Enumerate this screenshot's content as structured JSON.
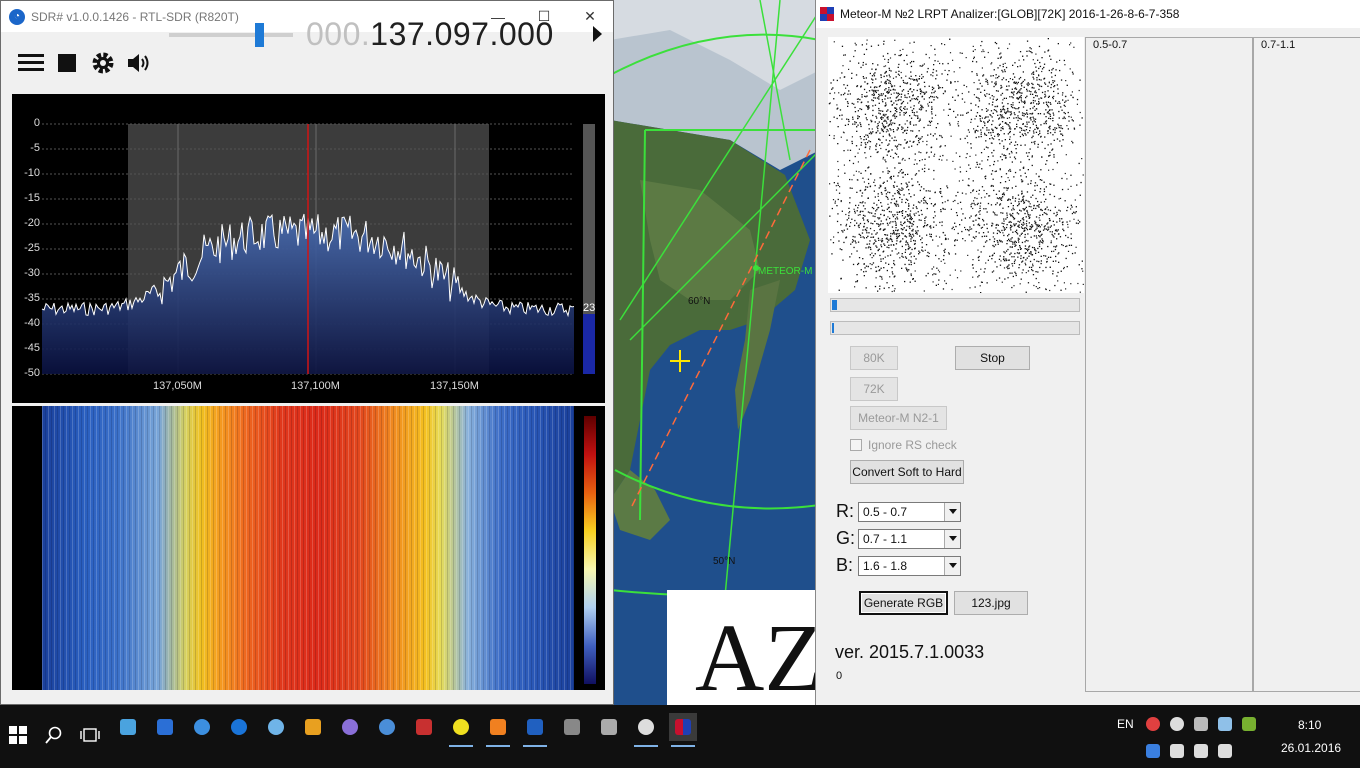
{
  "map": {
    "labels": {
      "satellite": "METEOR-M",
      "lat60": "60°N",
      "lat50": "50°N"
    },
    "overlay_text": "AZ"
  },
  "sdr": {
    "title": "SDR# v1.0.0.1426 - RTL-SDR (R820T)",
    "window_controls": {
      "minimize": "—",
      "maximize": "☐",
      "close": "✕"
    },
    "frequency": {
      "dim": "000.",
      "main": "137.097.000"
    },
    "volume_level": 0.75,
    "spectrum": {
      "y_ticks": [
        "0",
        "-5",
        "-10",
        "-15",
        "-20",
        "-25",
        "-30",
        "-35",
        "-40",
        "-45",
        "-50"
      ],
      "x_ticks": [
        "137,050M",
        "137,100M",
        "137,150M"
      ],
      "snr_value": "23"
    }
  },
  "meteor": {
    "title": "Meteor-M №2 LRPT Analizer:[GLOB][72K] 2016-1-26-8-6-7-358",
    "buttons": {
      "b80k": "80K",
      "b72k": "72K",
      "stop": "Stop",
      "meteor": "Meteor-M N2-1",
      "convert": "Convert Soft to Hard",
      "generate": "Generate RGB",
      "file": "123.jpg"
    },
    "ignore_rs": "Ignore RS check",
    "channels": {
      "r": {
        "label": "R:",
        "value": "0.5 - 0.7"
      },
      "g": {
        "label": "G:",
        "value": "0.7 - 1.1"
      },
      "b": {
        "label": "B:",
        "value": "1.6 - 1.8"
      }
    },
    "version": "ver. 2015.7.1.0033",
    "counter": "0",
    "panels": {
      "p1": "0.5-0.7",
      "p2": "0.7-1.1"
    },
    "progress1": 0.02,
    "progress2": 0.01
  },
  "taskbar": {
    "lang": "EN",
    "time": "8:10",
    "date": "26.01.2016"
  }
}
